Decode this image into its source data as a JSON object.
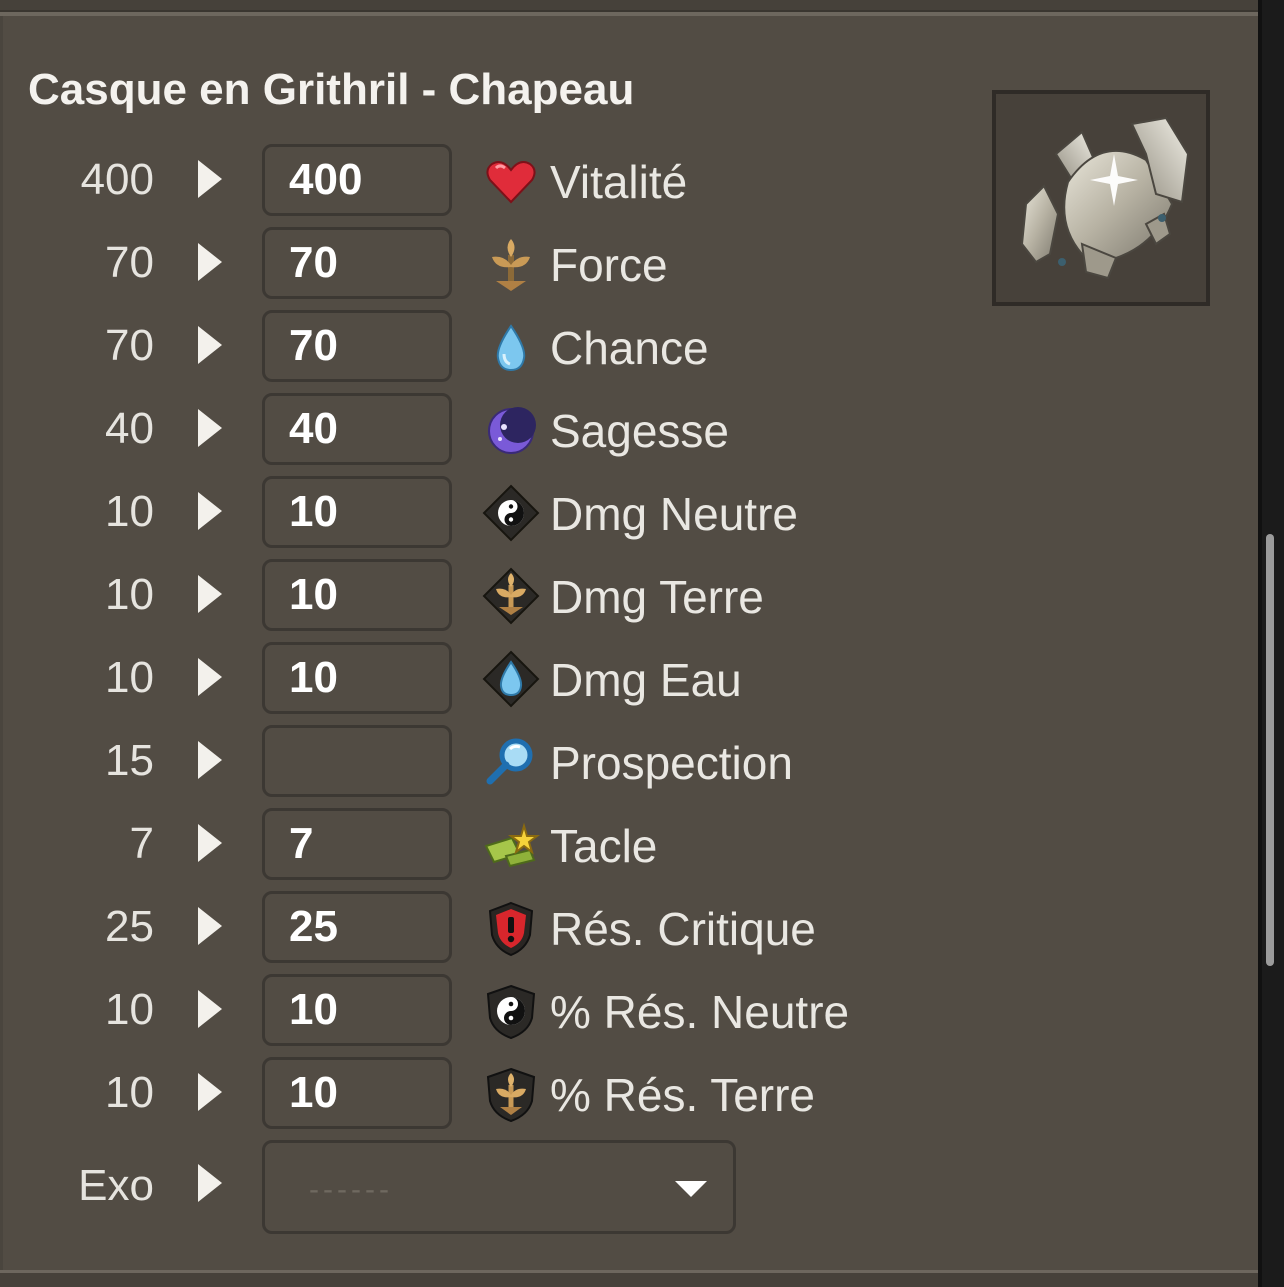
{
  "item": {
    "title": "Casque en Grithril - Chapeau"
  },
  "stats": [
    {
      "base": "400",
      "value": "400",
      "label": "Vitalité",
      "icon": "heart-icon"
    },
    {
      "base": "70",
      "value": "70",
      "label": "Force",
      "icon": "earth-sprout-icon"
    },
    {
      "base": "70",
      "value": "70",
      "label": "Chance",
      "icon": "water-drop-icon"
    },
    {
      "base": "40",
      "value": "40",
      "label": "Sagesse",
      "icon": "moon-icon"
    },
    {
      "base": "10",
      "value": "10",
      "label": "Dmg Neutre",
      "icon": "yin-yang-diamond-icon"
    },
    {
      "base": "10",
      "value": "10",
      "label": "Dmg Terre",
      "icon": "earth-diamond-icon"
    },
    {
      "base": "10",
      "value": "10",
      "label": "Dmg Eau",
      "icon": "water-diamond-icon"
    },
    {
      "base": "15",
      "value": "",
      "label": "Prospection",
      "icon": "magnifier-icon"
    },
    {
      "base": "7",
      "value": "7",
      "label": "Tacle",
      "icon": "tackle-icon"
    },
    {
      "base": "25",
      "value": "25",
      "label": "Rés. Critique",
      "icon": "critical-shield-icon"
    },
    {
      "base": "10",
      "value": "10",
      "label": "% Rés. Neutre",
      "icon": "yin-yang-shield-icon"
    },
    {
      "base": "10",
      "value": "10",
      "label": "% Rés. Terre",
      "icon": "earth-shield-icon"
    }
  ],
  "exo": {
    "label": "Exo",
    "selected": "------"
  }
}
